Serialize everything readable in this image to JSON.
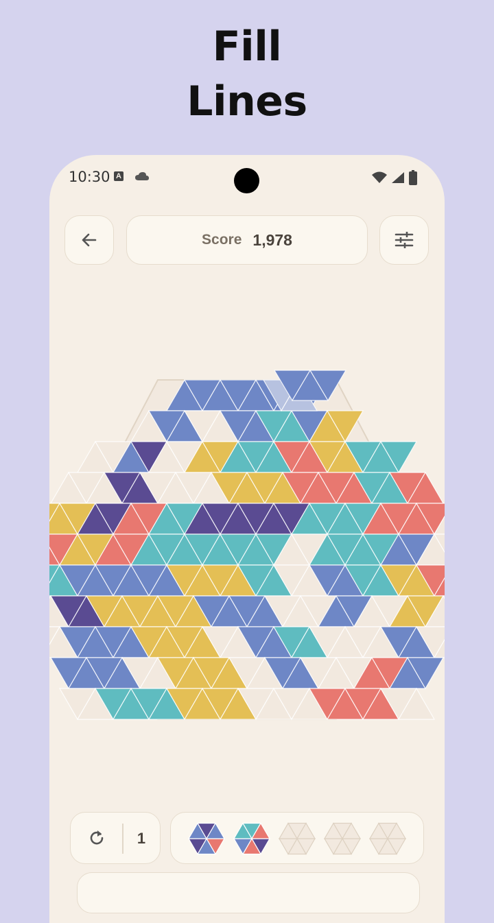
{
  "headline": {
    "line1": "Fill",
    "line2": "Lines"
  },
  "status_bar": {
    "time": "10:30",
    "notif_letter": "A"
  },
  "top_bar": {
    "score_label": "Score",
    "score_value": "1,978"
  },
  "bottom": {
    "undo_count": "1"
  },
  "colors": {
    "background": "#d5d3ee",
    "panel": "#f6efe6",
    "empty": "#f2e9df",
    "blue": "#6e87c6",
    "purple": "#5a4b92",
    "yellow": "#e4bf55",
    "teal": "#5fbcc0",
    "red": "#e87870",
    "ghost": "#b7c2e0"
  },
  "board": {
    "rows": [
      "....BBBBBBBB....",
      "...eBBeeBBTTBYY...",
      "..eeBPeeYYTTTRRYYTTT..",
      ".eeePPeeeeYYYYRRRRTTRR.",
      "YYYYPPRRTTPPPPPPTTTTRRRRee",
      "TTRRYYRRTTTTTTTTeeTTTTBBeeRR",
      "eeTTBBBBBBYYYYTTeeBBTTYYRRRR",
      ".eePPYYYYYYBBBBeeeBBeeYYee.",
      "..eeBBBBYYYYeeBBTTeeeeBBee..",
      "...BBBBeeYYYYeeBBeeeRRBB...",
      "....eeTTTTYYYYeeeeRRRRee...."
    ],
    "active_piece": "3 blue triangles (ghost preview at top)"
  },
  "pieces": [
    {
      "name": "piece-1",
      "colors": [
        "red",
        "blue",
        "purple",
        "blue",
        "purple",
        "blue"
      ]
    },
    {
      "name": "piece-2",
      "colors": [
        "purple",
        "red",
        "blue",
        "teal",
        "teal",
        "red"
      ]
    },
    {
      "name": "piece-3",
      "colors": []
    },
    {
      "name": "piece-4",
      "colors": []
    },
    {
      "name": "piece-5",
      "colors": []
    }
  ]
}
